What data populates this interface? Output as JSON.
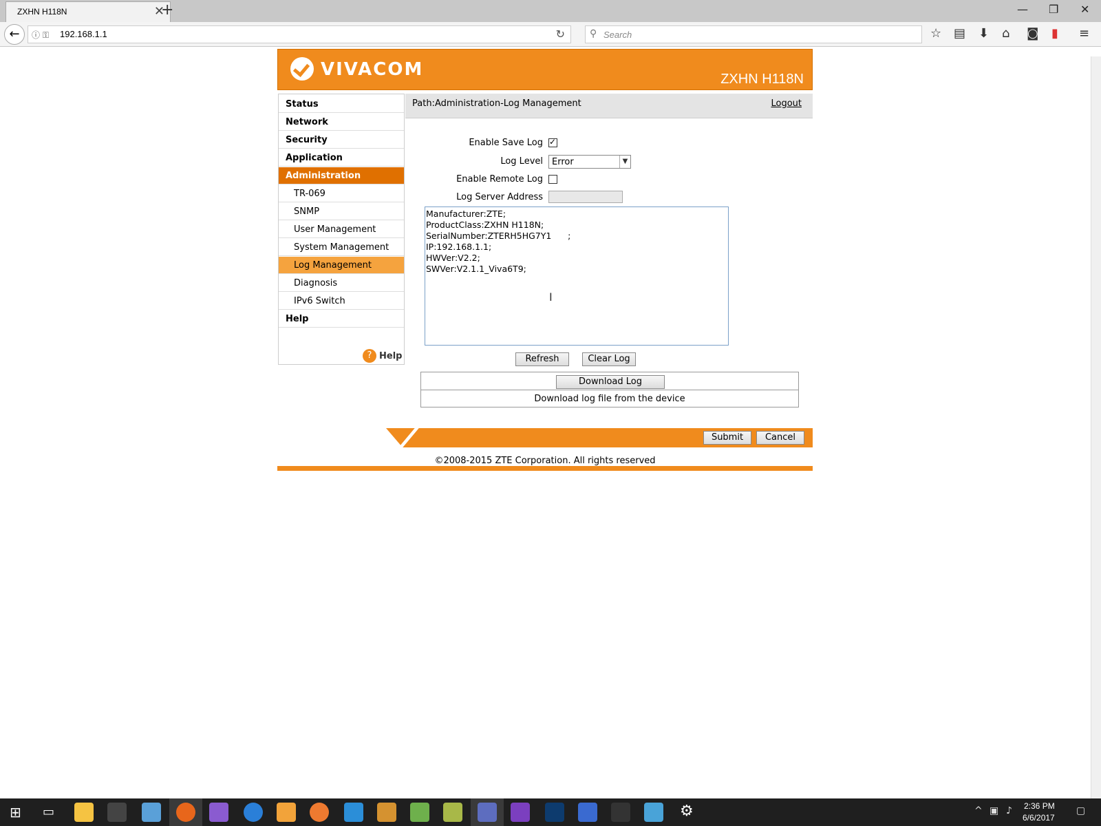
{
  "browser": {
    "tab_title": "ZXHN H118N",
    "tab_close": "✕",
    "new_tab": "+",
    "url": "192.168.1.1",
    "search_placeholder": "Search"
  },
  "router": {
    "brand": "VIVACOM",
    "model": "ZXHN H118N",
    "path": "Path:Administration-Log Management",
    "logout": "Logout"
  },
  "sidebar": {
    "items": [
      {
        "label": "Status",
        "level": "main",
        "active": false
      },
      {
        "label": "Network",
        "level": "main",
        "active": false
      },
      {
        "label": "Security",
        "level": "main",
        "active": false
      },
      {
        "label": "Application",
        "level": "main",
        "active": false
      },
      {
        "label": "Administration",
        "level": "main",
        "active": true
      },
      {
        "label": "TR-069",
        "level": "sub",
        "active": false
      },
      {
        "label": "SNMP",
        "level": "sub",
        "active": false
      },
      {
        "label": "User Management",
        "level": "sub",
        "active": false
      },
      {
        "label": "System Management",
        "level": "sub",
        "active": false
      },
      {
        "label": "Log Management",
        "level": "sub",
        "active": true
      },
      {
        "label": "Diagnosis",
        "level": "sub",
        "active": false
      },
      {
        "label": "IPv6 Switch",
        "level": "sub",
        "active": false
      },
      {
        "label": "Help",
        "level": "main",
        "active": false
      }
    ],
    "help_label": "Help",
    "help_glyph": "?"
  },
  "form": {
    "enable_save_log_label": "Enable Save Log",
    "enable_save_log_checked": true,
    "log_level_label": "Log Level",
    "log_level_value": "Error",
    "enable_remote_log_label": "Enable Remote Log",
    "enable_remote_log_checked": false,
    "log_server_label": "Log Server Address",
    "log_server_value": ""
  },
  "log": {
    "lines": [
      "Manufacturer:ZTE;",
      "ProductClass:ZXHN H118N;",
      "SerialNumber:ZTERH5HG7Y1      ;",
      "IP:192.168.1.1;",
      "HWVer:V2.2;",
      "SWVer:V2.1.1_Viva6T9;"
    ]
  },
  "buttons": {
    "refresh": "Refresh",
    "clear_log": "Clear Log",
    "download_log": "Download Log",
    "download_desc": "Download log file from the device",
    "submit": "Submit",
    "cancel": "Cancel"
  },
  "footer": {
    "copyright": "©2008-2015 ZTE Corporation. All rights reserved"
  },
  "taskbar": {
    "time": "2:36 PM",
    "date": "6/6/2017"
  },
  "colors": {
    "brand_orange": "#f08b1d",
    "active_main": "#e07000",
    "active_sub": "#f5a33e"
  }
}
